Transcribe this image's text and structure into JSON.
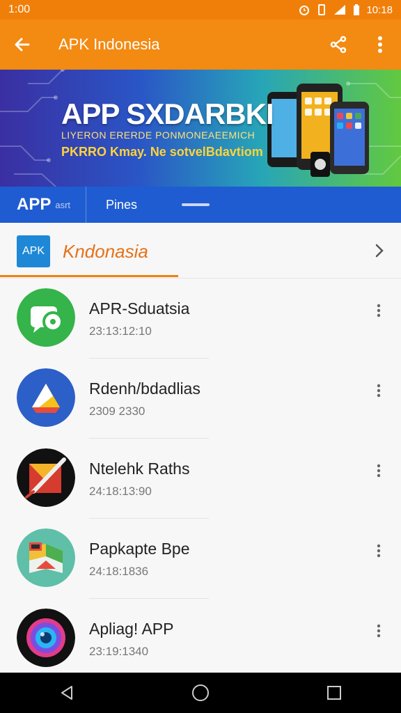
{
  "status_bar": {
    "time": "1:00",
    "clock": "10:18",
    "icons": [
      "alarm-icon",
      "vibrate-icon",
      "signal-icon",
      "battery-icon"
    ]
  },
  "app_bar": {
    "title": "APK Indonesia",
    "back_icon": "arrow-back-icon",
    "share_icon": "share-icon",
    "more_icon": "more-vert-icon"
  },
  "banner": {
    "title": "APP SXDARBKI",
    "subtitle1": "LIYERON ERERDE PONMONEAEEMICH",
    "subtitle2": "PKRRO Kmay. Ne sotvelBdavtiom"
  },
  "tabs": {
    "app_label": "APP",
    "app_sub": "asrt",
    "second_label": "Pines"
  },
  "section": {
    "badge": "APK",
    "title": "Kndonasia",
    "chevron_icon": "chevron-right-icon"
  },
  "apps": [
    {
      "name": "APR-Sduatsia",
      "meta": "23:13:12:10",
      "icon": "chat-bubble-icon"
    },
    {
      "name": "Rdenh/bdadlias",
      "meta": "2309 2330",
      "icon": "drive-triangle-icon"
    },
    {
      "name": "Ntelehk Raths",
      "meta": "24:18:13:90",
      "icon": "pen-tool-icon"
    },
    {
      "name": "Papkapte Bpe",
      "meta": "24:18:1836",
      "icon": "maps-icon"
    },
    {
      "name": "Apliag! APP",
      "meta": "23:19:1340",
      "icon": "camera-lens-icon"
    }
  ],
  "nav": {
    "back": "nav-back-icon",
    "home": "nav-home-icon",
    "recents": "nav-recents-icon"
  },
  "colors": {
    "accent": "#f38a12",
    "tab_blue": "#1f5cd1",
    "section_orange": "#e5711a"
  }
}
